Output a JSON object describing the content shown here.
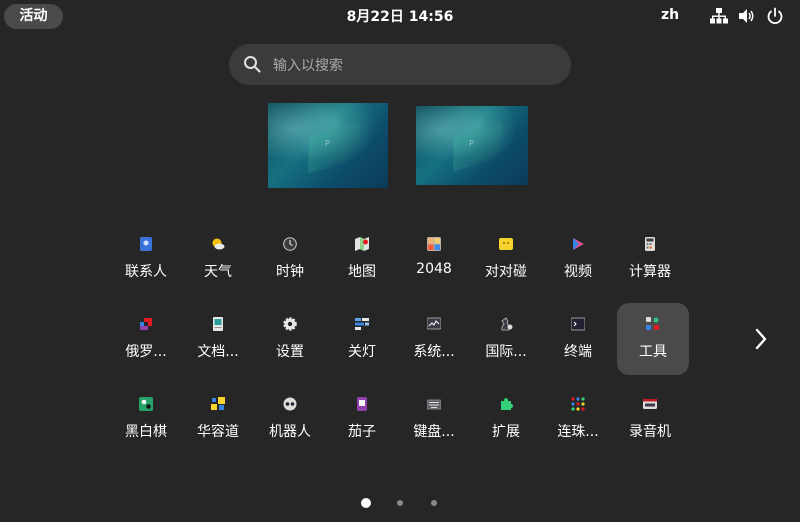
{
  "topbar": {
    "activities_label": "活动",
    "clock": "8月22日  14:56",
    "language": "zh",
    "tray_icons": [
      "network-icon",
      "volume-icon",
      "power-icon"
    ]
  },
  "search": {
    "placeholder": "输入以搜索"
  },
  "workspaces": [
    {
      "logo": "P"
    },
    {
      "logo": "P"
    }
  ],
  "apps": [
    {
      "label": "联系人",
      "icon": "contacts-icon"
    },
    {
      "label": "天气",
      "icon": "weather-icon"
    },
    {
      "label": "时钟",
      "icon": "clock-icon"
    },
    {
      "label": "地图",
      "icon": "maps-icon"
    },
    {
      "label": "2048",
      "icon": "game-2048-icon"
    },
    {
      "label": "对对碰",
      "icon": "swell-foop-icon"
    },
    {
      "label": "视频",
      "icon": "video-icon"
    },
    {
      "label": "计算器",
      "icon": "calculator-icon"
    },
    {
      "label": "俄罗...",
      "icon": "tetris-icon"
    },
    {
      "label": "文档...",
      "icon": "document-viewer-icon"
    },
    {
      "label": "设置",
      "icon": "settings-icon"
    },
    {
      "label": "关灯",
      "icon": "lights-off-icon"
    },
    {
      "label": "系统...",
      "icon": "system-monitor-icon"
    },
    {
      "label": "国际...",
      "icon": "chess-icon"
    },
    {
      "label": "终端",
      "icon": "terminal-icon"
    },
    {
      "label": "工具",
      "icon": "tools-folder-icon",
      "selected": true
    },
    {
      "label": "黑白棋",
      "icon": "reversi-icon"
    },
    {
      "label": "华容道",
      "icon": "klotski-icon"
    },
    {
      "label": "机器人",
      "icon": "robots-icon"
    },
    {
      "label": "茄子",
      "icon": "eggplant-icon"
    },
    {
      "label": "键盘...",
      "icon": "keyboard-icon"
    },
    {
      "label": "扩展",
      "icon": "extensions-icon"
    },
    {
      "label": "连珠...",
      "icon": "five-in-row-icon"
    },
    {
      "label": "录音机",
      "icon": "sound-recorder-icon"
    }
  ],
  "pagination": {
    "pages": 3,
    "current": 1
  },
  "colors": {
    "background": "#262626",
    "selected": "#4a4a4a",
    "search_bg": "#3b3b3b"
  }
}
